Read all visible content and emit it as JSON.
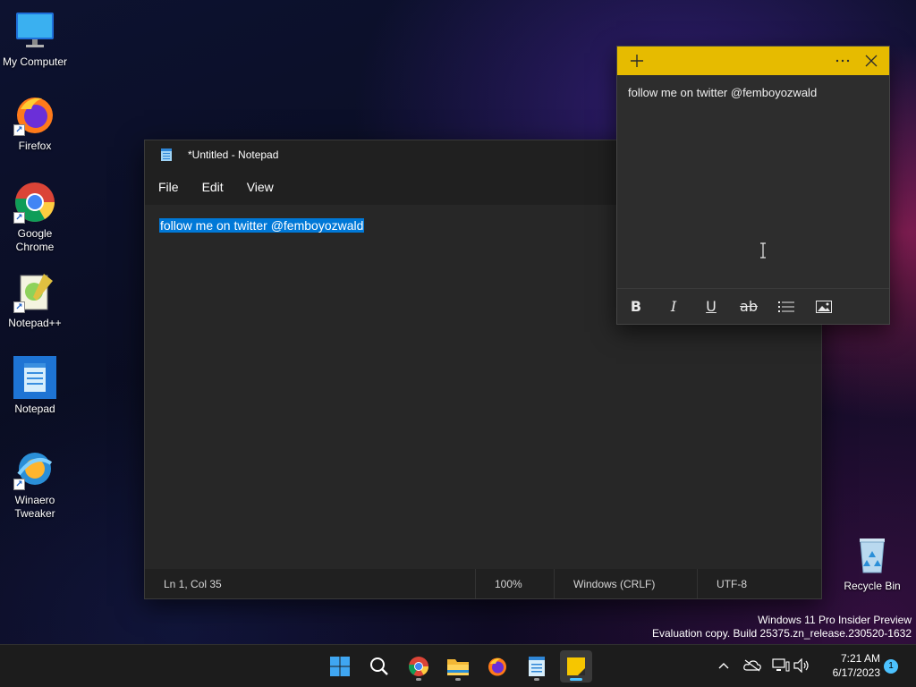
{
  "desktop": {
    "icons": [
      {
        "label": "My Computer"
      },
      {
        "label": "Firefox"
      },
      {
        "label": "Google Chrome"
      },
      {
        "label": "Notepad++"
      },
      {
        "label": "Notepad"
      },
      {
        "label": "Winaero Tweaker"
      },
      {
        "label": "Recycle Bin"
      }
    ]
  },
  "notepad": {
    "title": "*Untitled - Notepad",
    "menu": [
      "File",
      "Edit",
      "View"
    ],
    "content": "follow me on twitter @femboyozwald",
    "status": {
      "position": "Ln 1, Col 35",
      "zoom": "100%",
      "line_ending": "Windows (CRLF)",
      "encoding": "UTF-8"
    }
  },
  "sticky_note": {
    "text": "follow me on twitter @femboyozwald",
    "header_color": "#e6bb00",
    "toolbar": [
      "bold-icon",
      "italic-icon",
      "underline-icon",
      "strikethrough-icon",
      "bullets-icon",
      "image-icon"
    ]
  },
  "watermark": {
    "line1": "Windows 11 Pro Insider Preview",
    "line2": "Evaluation copy. Build 25375.zn_release.230520-1632"
  },
  "taskbar": {
    "apps": [
      "start-icon",
      "search-icon",
      "chrome-icon",
      "file-explorer-icon",
      "firefox-icon",
      "notepad-icon",
      "sticky-notes-icon"
    ],
    "time": "7:21 AM",
    "date": "6/17/2023",
    "notifications": "1",
    "accent": "#4cc2ff"
  }
}
